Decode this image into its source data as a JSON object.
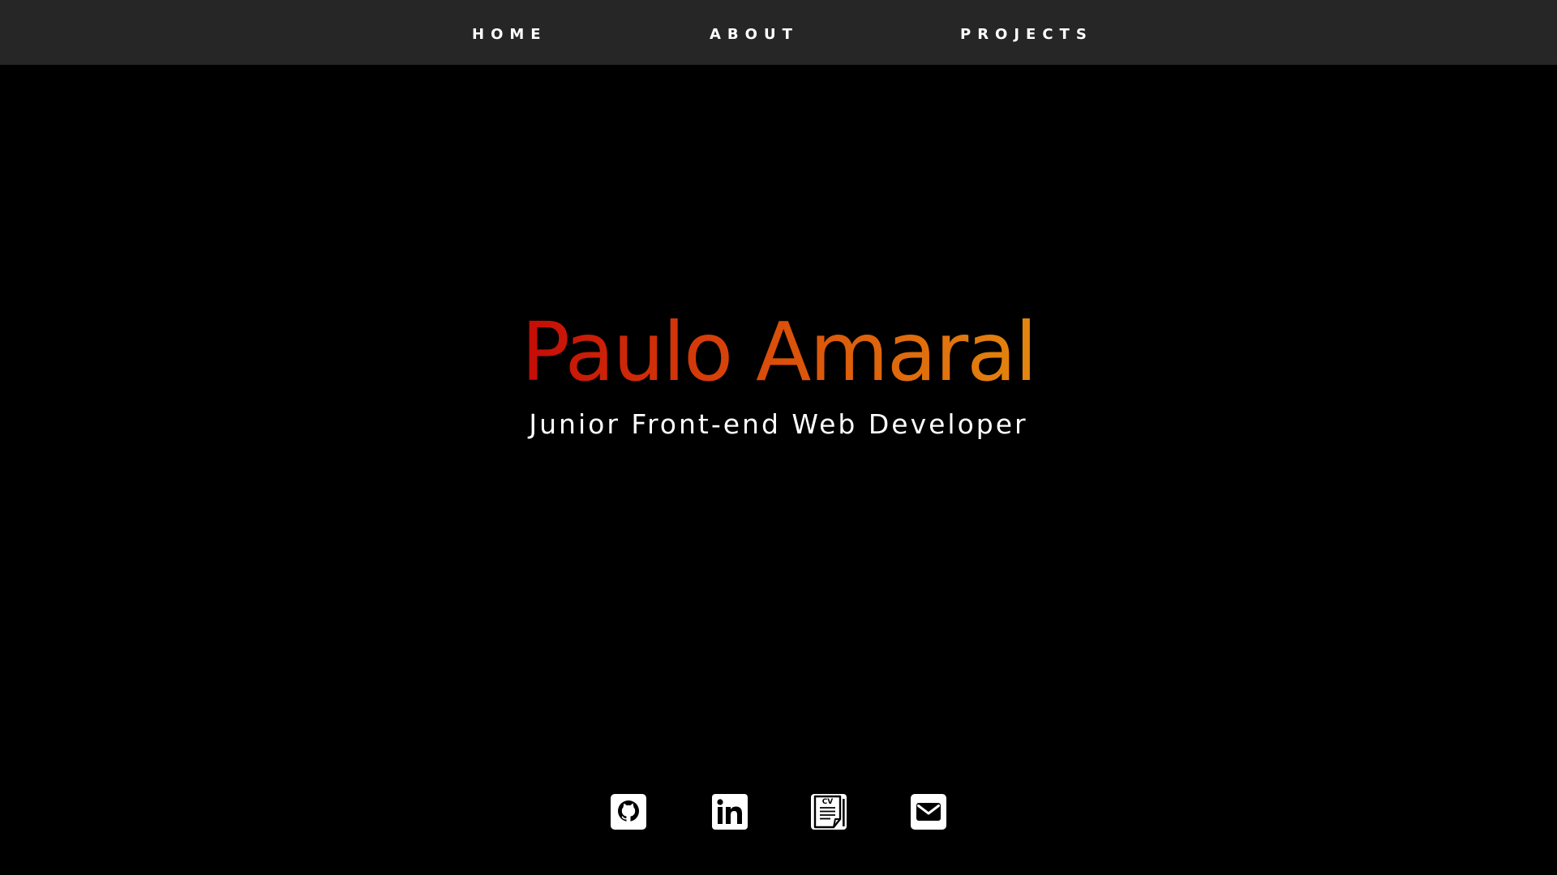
{
  "nav": {
    "items": [
      {
        "label": "HOME"
      },
      {
        "label": "ABOUT"
      },
      {
        "label": "PROJECTS"
      }
    ]
  },
  "hero": {
    "name": "Paulo Amaral",
    "subtitle": "Junior Front-end Web Developer",
    "gradient_colors": [
      "#c40b06",
      "#e3870f"
    ]
  },
  "socials": [
    {
      "icon": "github-icon"
    },
    {
      "icon": "linkedin-icon"
    },
    {
      "icon": "cv-document-icon",
      "badge": "CV"
    },
    {
      "icon": "email-icon"
    }
  ],
  "colors": {
    "background": "#000000",
    "navbar": "#262626",
    "text": "#ffffff"
  }
}
